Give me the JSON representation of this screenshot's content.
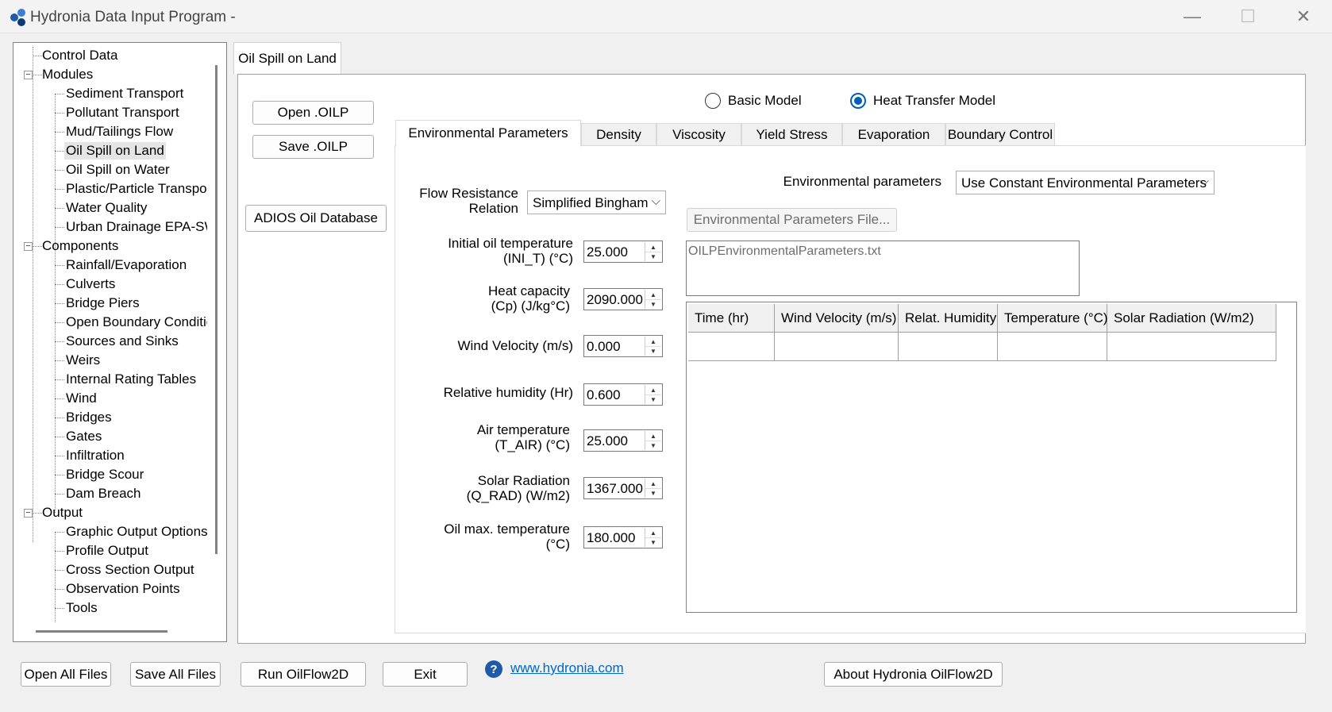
{
  "window": {
    "title": "Hydronia Data Input Program -",
    "minimize_glyph": "—",
    "maximize_glyph": "☐",
    "close_glyph": "✕"
  },
  "tree": {
    "items": [
      {
        "label": "Control Data"
      },
      {
        "label": "Modules"
      },
      {
        "label": "Sediment Transport"
      },
      {
        "label": "Pollutant Transport"
      },
      {
        "label": "Mud/Tailings Flow"
      },
      {
        "label": "Oil Spill on Land"
      },
      {
        "label": "Oil Spill on Water"
      },
      {
        "label": "Plastic/Particle Transport"
      },
      {
        "label": "Water Quality"
      },
      {
        "label": "Urban Drainage EPA-SWMM"
      },
      {
        "label": "Components"
      },
      {
        "label": "Rainfall/Evaporation"
      },
      {
        "label": "Culverts"
      },
      {
        "label": "Bridge Piers"
      },
      {
        "label": "Open Boundary Conditions"
      },
      {
        "label": "Sources and Sinks"
      },
      {
        "label": "Weirs"
      },
      {
        "label": "Internal Rating Tables"
      },
      {
        "label": "Wind"
      },
      {
        "label": "Bridges"
      },
      {
        "label": "Gates"
      },
      {
        "label": "Infiltration"
      },
      {
        "label": "Bridge Scour"
      },
      {
        "label": "Dam Breach"
      },
      {
        "label": "Output"
      },
      {
        "label": "Graphic Output Options"
      },
      {
        "label": "Profile Output"
      },
      {
        "label": "Cross Section Output"
      },
      {
        "label": "Observation Points"
      },
      {
        "label": "Tools"
      }
    ],
    "selected": "Oil Spill on Land",
    "expander_glyph": "−"
  },
  "main_tab": {
    "label": "Oil Spill on Land"
  },
  "buttons": {
    "open_oilp": "Open .OILP",
    "save_oilp": "Save .OILP",
    "adios": "ADIOS Oil Database",
    "env_file": "Environmental Parameters File..."
  },
  "model": {
    "basic": "Basic Model",
    "heat": "Heat Transfer Model",
    "selected": "heat"
  },
  "tabs": [
    "Environmental Parameters",
    "Density",
    "Viscosity",
    "Yield Stress",
    "Evaporation",
    "Boundary Control"
  ],
  "active_tab": "Environmental Parameters",
  "flow_resistance": {
    "label_line1": "Flow Resistance",
    "label_line2": "Relation",
    "value": "Simplified Bingham"
  },
  "fields": {
    "ini_t": {
      "label1": "Initial oil temperature",
      "label2": "(INI_T) (°C)",
      "value": "25.000"
    },
    "cp": {
      "label1": "Heat capacity",
      "label2": "(Cp) (J/kg°C)",
      "value": "2090.000"
    },
    "wind": {
      "label1": "Wind Velocity (m/s)",
      "label2": "",
      "value": "0.000"
    },
    "hr": {
      "label1": "Relative humidity (Hr)",
      "label2": "",
      "value": "0.600"
    },
    "t_air": {
      "label1": "Air temperature",
      "label2": "(T_AIR) (°C)",
      "value": "25.000"
    },
    "q_rad": {
      "label1": "Solar Radiation",
      "label2": "(Q_RAD) (W/m2)",
      "value": "1367.000"
    },
    "oil_max": {
      "label1": "Oil max. temperature",
      "label2": "(°C)",
      "value": "180.000"
    }
  },
  "env_params": {
    "label": "Environmental parameters",
    "value": "Use Constant Environmental Parameters"
  },
  "env_file_textbox": "OILPEnvironmentalParameters.txt",
  "grid": {
    "columns": [
      "Time (hr)",
      "Wind Velocity (m/s)",
      "Relat. Humidity",
      "Temperature (°C)",
      "Solar Radiation (W/m2)"
    ]
  },
  "bottom": {
    "open_all": "Open All Files",
    "save_all": "Save All Files",
    "run": "Run OilFlow2D",
    "exit": "Exit",
    "link": "www.hydronia.com",
    "about": "About Hydronia OilFlow2D",
    "help_glyph": "?"
  },
  "colors": {
    "accent": "#005fb8",
    "link": "#0066cc",
    "selected_bg": "#e5e5e5"
  }
}
